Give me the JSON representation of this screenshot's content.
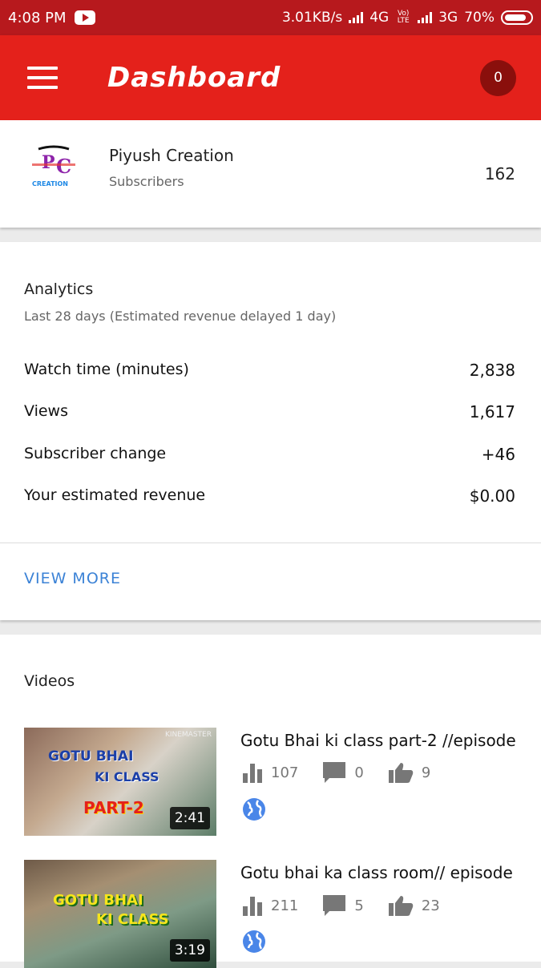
{
  "status_bar": {
    "time": "4:08 PM",
    "speed": "3.01KB/s",
    "network1": "4G",
    "volte": "Vo) LTE",
    "network2": "3G",
    "battery": "70%"
  },
  "app_bar": {
    "title": "Dashboard",
    "notification_count": "0"
  },
  "channel": {
    "name": "Piyush Creation",
    "subscribers_label": "Subscribers",
    "subscribers_count": "162",
    "logo_text": "PC PIYUSH CREATION"
  },
  "analytics": {
    "title": "Analytics",
    "subtitle": "Last 28 days (Estimated revenue delayed 1 day)",
    "rows": [
      {
        "label": "Watch time (minutes)",
        "value": "2,838"
      },
      {
        "label": "Views",
        "value": "1,617"
      },
      {
        "label": "Subscriber change",
        "value": "+46"
      },
      {
        "label": "Your estimated revenue",
        "value": "$0.00"
      }
    ],
    "view_more": "VIEW MORE"
  },
  "videos": {
    "title": "Videos",
    "items": [
      {
        "title": "Gotu Bhai ki class part-2 //episode",
        "duration": "2:41",
        "views": "107",
        "comments": "0",
        "likes": "9",
        "thumb_lines": [
          "GOTU BHAI",
          "KI CLASS",
          "PART-2"
        ],
        "thumb_brand": "KINEMASTER"
      },
      {
        "title": "Gotu bhai ka class room// episode",
        "duration": "3:19",
        "views": "211",
        "comments": "5",
        "likes": "23",
        "thumb_lines": [
          "GOTU BHAI",
          "KI CLASS"
        ]
      }
    ]
  },
  "colors": {
    "app_bar": "#e4211b",
    "status_bar": "#b7191d",
    "link": "#3b82d6",
    "globe": "#4a86e8"
  }
}
